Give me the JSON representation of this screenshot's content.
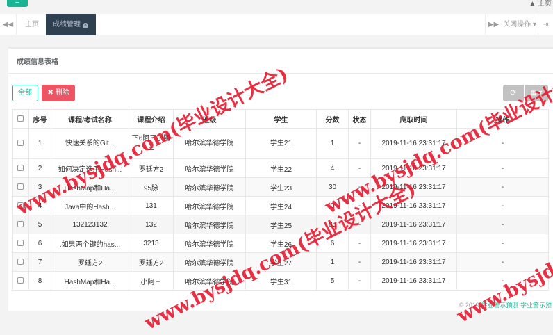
{
  "topbar": {
    "menu_glyph": "≡",
    "right_text": "▲ 主页"
  },
  "tabs": {
    "prev_glyph": "◀◀",
    "home_label": "主页",
    "active_label": "成绩管理",
    "close_glyph": "×",
    "next_glyph": "▶▶",
    "close_ops_label": "关闭操作 ▾",
    "exit_glyph": "⇥"
  },
  "panel": {
    "title": "成绩信息表格"
  },
  "toolbar": {
    "all_label": "全部",
    "delete_icon": "✖",
    "delete_label": "删除",
    "refresh_glyph": "⟳",
    "columns_glyph": "▦ ▾"
  },
  "table": {
    "headers": [
      "序号",
      "课程/考试名称",
      "课程介绍",
      "班级",
      "学生",
      "分数",
      "状态",
      "爬取时间",
      "操作"
    ],
    "rows": [
      [
        "1",
        "快速关系的Git...",
        "下6阿三小阿三",
        "哈尔滨华德学院",
        "学生21",
        "1",
        "-",
        "2019-11-16 23:31:17",
        "-"
      ],
      [
        "2",
        "如何决定选用Hash...",
        "罗廷方2",
        "哈尔滨华德学院",
        "学生22",
        "4",
        "-",
        "2019-11-16 23:31:17",
        "-"
      ],
      [
        "3",
        "HashMap和Ha...",
        "95脉",
        "哈尔滨华德学院",
        "学生23",
        "30",
        "-",
        "2019-11-16 23:31:17",
        "-"
      ],
      [
        "4",
        "Java中的Hash...",
        "131",
        "哈尔滨华德学院",
        "学生24",
        "0",
        "-",
        "2019-11-16 23:31:17",
        "-"
      ],
      [
        "5",
        "132123132",
        "132",
        "哈尔滨华德学院",
        "学生25",
        "85",
        "-",
        "2019-11-16 23:31:17",
        "-"
      ],
      [
        "6",
        ".如果两个键的has...",
        "3213",
        "哈尔滨华德学院",
        "学生26",
        "6",
        "-",
        "2019-11-16 23:31:17",
        "-"
      ],
      [
        "7",
        "罗廷方2",
        "罗廷方2",
        "哈尔滨华德学院",
        "学生27",
        "1",
        "-",
        "2019-11-16 23:31:17",
        "-"
      ],
      [
        "8",
        "HashMap和Ha...",
        "小阿三",
        "哈尔滨华德学院",
        "学生31",
        "5",
        "-",
        "2019-11-16 23:31:17",
        "-"
      ]
    ]
  },
  "footer": {
    "copyright": "© 2019",
    "link1": "学业警示预测",
    "link2": "学业警示预"
  },
  "watermark": {
    "text": "www.bysjdq.com(毕业设计大全)",
    "color": "#e5142b"
  }
}
